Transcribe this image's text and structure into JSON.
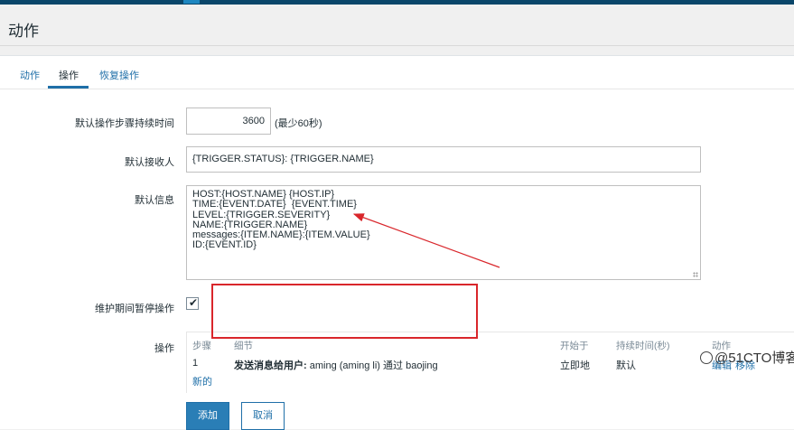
{
  "page": {
    "title": "动作"
  },
  "tabs": [
    {
      "label": "动作"
    },
    {
      "label": "操作"
    },
    {
      "label": "恢复操作"
    }
  ],
  "form": {
    "duration_label": "默认操作步骤持续时间",
    "duration_value": "3600",
    "duration_hint": "(最少60秒)",
    "subject_label": "默认接收人",
    "subject_value": "{TRIGGER.STATUS}: {TRIGGER.NAME}",
    "message_label": "默认信息",
    "message_value": "HOST:{HOST.NAME} {HOST.IP}\nTIME:{EVENT.DATE}  {EVENT.TIME}\nLEVEL:{TRIGGER.SEVERITY}\nNAME:{TRIGGER.NAME}\nmessages:{ITEM.NAME}:{ITEM.VALUE}\nID:{EVENT.ID}",
    "pause_label": "维护期间暂停操作",
    "pause_checked": true,
    "operations_label": "操作"
  },
  "operations_table": {
    "headers": {
      "steps": "步骤",
      "details": "细节",
      "start_in": "开始于",
      "duration": "持续时间(秒)",
      "action": "动作"
    },
    "rows": [
      {
        "steps": "1",
        "details_bold": "发送消息给用户:",
        "details_rest": " aming (aming li) 通过 baojing",
        "start_in": "立即地",
        "duration": "默认",
        "edit": "编辑",
        "remove": "移除"
      }
    ],
    "new_link": "新的"
  },
  "buttons": {
    "add": "添加",
    "cancel": "取消"
  },
  "watermark": "@51CTO博客",
  "colors": {
    "accent": "#1f6fa8",
    "annotation": "#d9262b",
    "topbar": "#0a466a"
  }
}
